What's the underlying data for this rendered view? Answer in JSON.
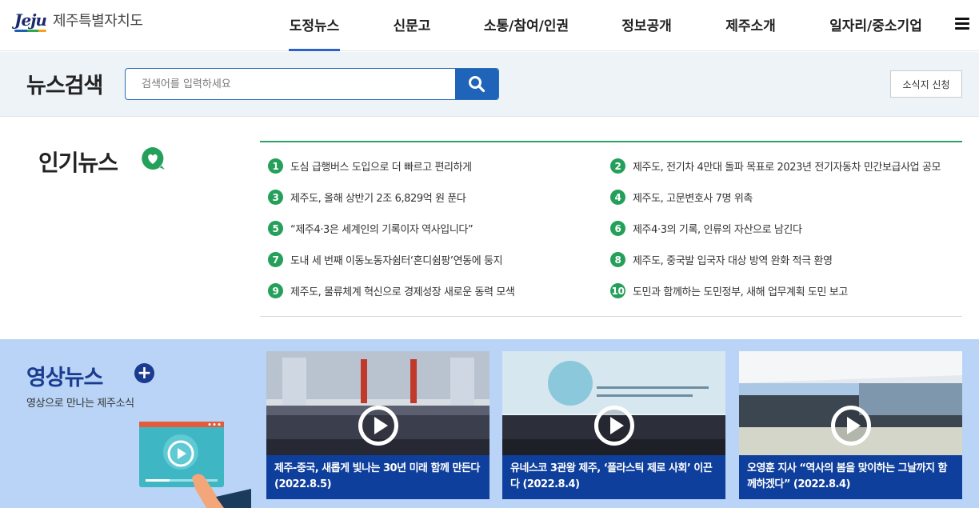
{
  "header": {
    "logo_mark": "Jeju",
    "logo_name": "제주특별자치도",
    "nav": [
      "도정뉴스",
      "신문고",
      "소통/참여/인권",
      "정보공개",
      "제주소개",
      "일자리/중소기업"
    ],
    "active_nav": "도정뉴스"
  },
  "search": {
    "title": "뉴스검색",
    "placeholder": "검색어를 입력하세요",
    "subscribe_label": "소식지 신청"
  },
  "popular": {
    "title": "인기뉴스",
    "items": [
      {
        "rank": "1",
        "text": "도심 급행버스 도입으로 더 빠르고 편리하게"
      },
      {
        "rank": "2",
        "text": "제주도, 전기차 4만대 돌파 목표로 2023년 전기자동차 민간보급사업 공모"
      },
      {
        "rank": "3",
        "text": "제주도, 올해 상반기 2조 6,829억 원 푼다"
      },
      {
        "rank": "4",
        "text": "제주도, 고문변호사 7명 위촉"
      },
      {
        "rank": "5",
        "text": "“제주4·3은 세계인의 기록이자 역사입니다”"
      },
      {
        "rank": "6",
        "text": "제주4·3의 기록, 인류의 자산으로 남긴다"
      },
      {
        "rank": "7",
        "text": "도내 세 번째 이동노동자쉼터‘혼디쉼팡’연동에 둥지"
      },
      {
        "rank": "8",
        "text": "제주도, 중국발 입국자 대상 방역 완화 적극 환영"
      },
      {
        "rank": "9",
        "text": "제주도, 물류체계 혁신으로 경제성장 새로운 동력 모색"
      },
      {
        "rank": "10",
        "text": "도민과 함께하는 도민정부, 새해 업무계획 도민 보고"
      }
    ]
  },
  "video": {
    "title": "영상뉴스",
    "subtitle": "영상으로 만나는 제주소식",
    "cards": [
      {
        "caption": "제주-중국, 새롭게 빛나는 30년 미래 함께 만든다 (2022.8.5)"
      },
      {
        "caption": "유네스코 3관왕 제주, ‘플라스틱 제로 사회’ 이끈다 (2022.8.4)"
      },
      {
        "caption": "오영훈 지사 “역사의 봄을 맞이하는 그날까지 함께하겠다” (2022.8.4)"
      }
    ]
  },
  "colors": {
    "accent_blue": "#1f64b8",
    "rank_green": "#24a05a",
    "video_band": "#b9d4f6",
    "caption_blue": "#0f3f9c"
  }
}
